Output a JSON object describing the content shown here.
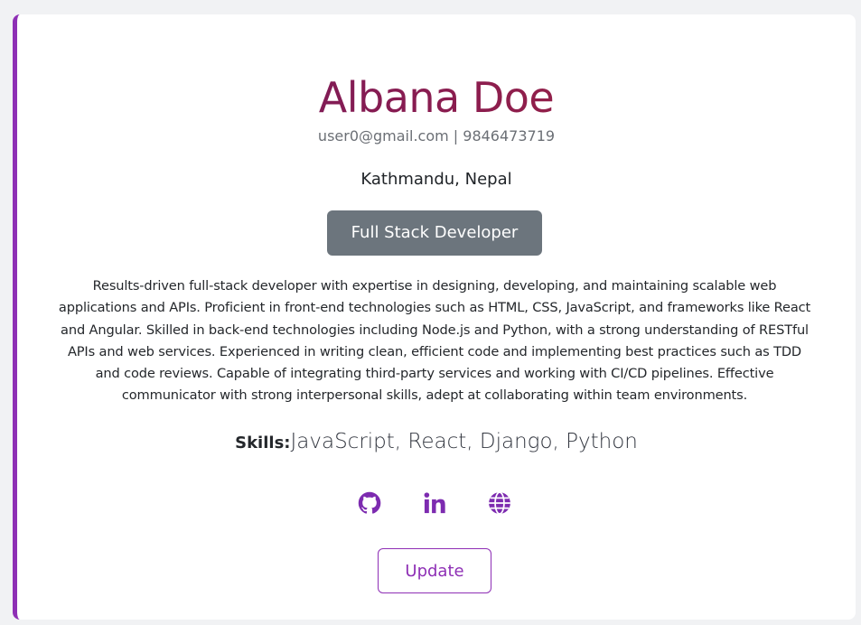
{
  "profile": {
    "name": "Albana Doe",
    "email": "user0@gmail.com",
    "separator": " | ",
    "phone": "9846473719",
    "location": "Kathmandu, Nepal",
    "role": "Full Stack Developer",
    "summary": "Results-driven full-stack developer with expertise in designing, developing, and maintaining scalable web applications and APIs. Proficient in front-end technologies such as HTML, CSS, JavaScript, and frameworks like React and Angular. Skilled in back-end technologies including Node.js and Python, with a strong understanding of RESTful APIs and web services. Experienced in writing clean, efficient code and implementing best practices such as TDD and code reviews. Capable of integrating third-party services and working with CI/CD pipelines. Effective communicator with strong interpersonal skills, adept at collaborating within team environments.",
    "skills_label": "Skills:",
    "skills": "JavaScript, React, Django, Python"
  },
  "socials": [
    {
      "icon": "github-icon"
    },
    {
      "icon": "linkedin-icon"
    },
    {
      "icon": "globe-icon"
    }
  ],
  "actions": {
    "update_label": "Update"
  },
  "colors": {
    "accent": "#8e2fb5",
    "name_gradient_start": "#6f1a63",
    "name_gradient_end": "#a82a3a",
    "role_button_bg": "#6c757d"
  }
}
